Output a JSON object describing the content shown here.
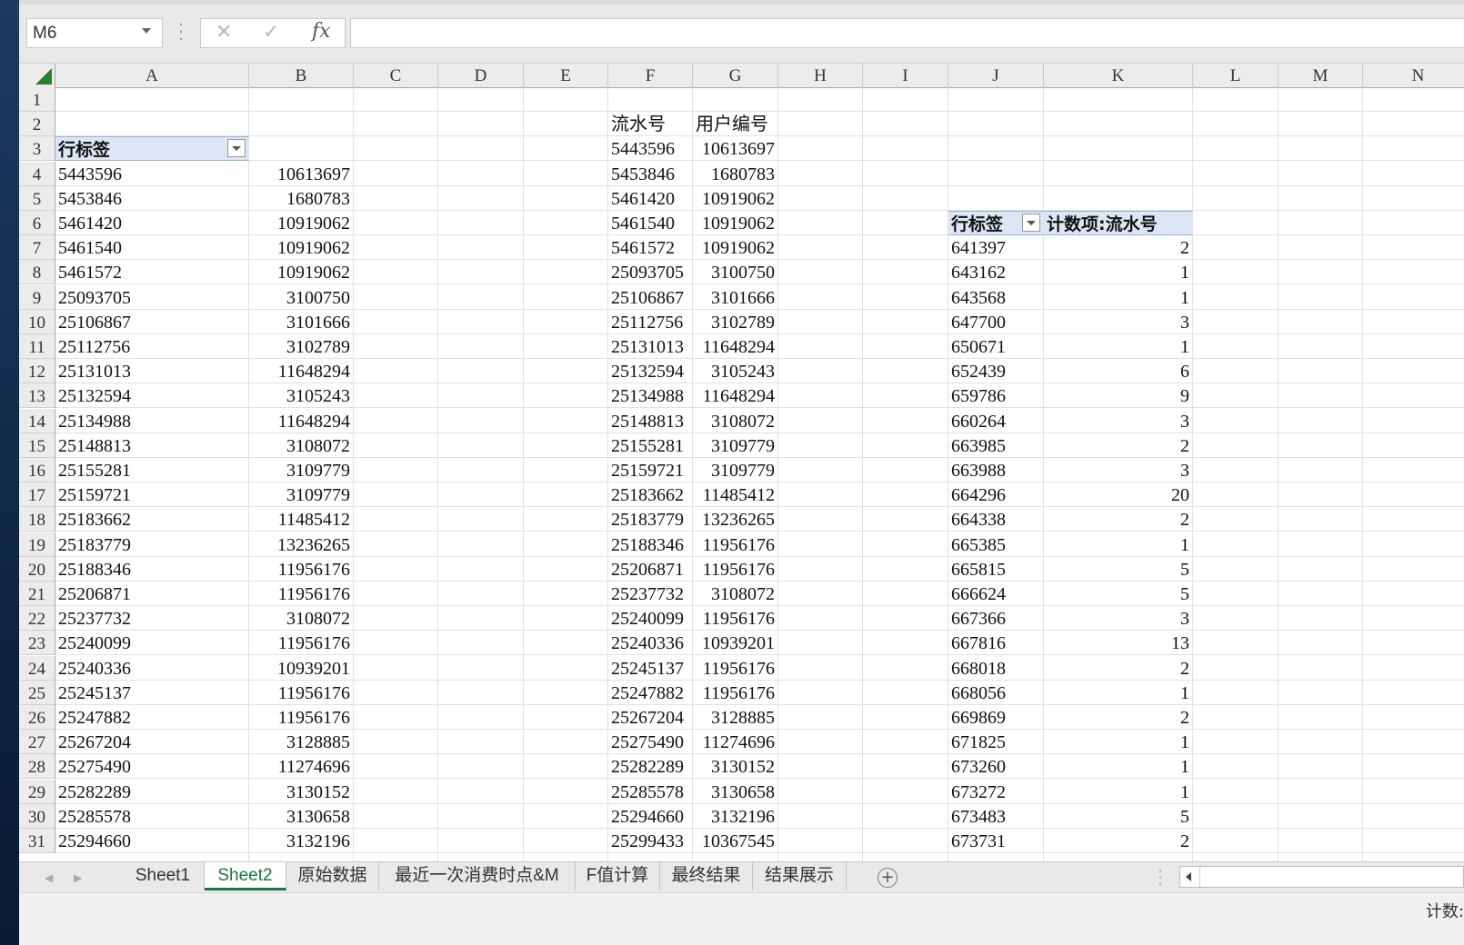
{
  "name_box": {
    "value": "M6"
  },
  "formula_bar": {
    "fx_label": "fx",
    "value": ""
  },
  "columns": [
    "A",
    "B",
    "C",
    "D",
    "E",
    "F",
    "G",
    "H",
    "I",
    "J",
    "K",
    "L",
    "M",
    "N"
  ],
  "rows": [
    "1",
    "2",
    "3",
    "4",
    "5",
    "6",
    "7",
    "8",
    "9",
    "10",
    "11",
    "12",
    "13",
    "14",
    "15",
    "16",
    "17",
    "18",
    "19",
    "20",
    "21",
    "22",
    "23",
    "24",
    "25",
    "26",
    "27",
    "28",
    "29",
    "30",
    "31"
  ],
  "pivot_left": {
    "header": "行标签",
    "rows": [
      [
        "5443596",
        "10613697"
      ],
      [
        "5453846",
        "1680783"
      ],
      [
        "5461420",
        "10919062"
      ],
      [
        "5461540",
        "10919062"
      ],
      [
        "5461572",
        "10919062"
      ],
      [
        "25093705",
        "3100750"
      ],
      [
        "25106867",
        "3101666"
      ],
      [
        "25112756",
        "3102789"
      ],
      [
        "25131013",
        "11648294"
      ],
      [
        "25132594",
        "3105243"
      ],
      [
        "25134988",
        "11648294"
      ],
      [
        "25148813",
        "3108072"
      ],
      [
        "25155281",
        "3109779"
      ],
      [
        "25159721",
        "3109779"
      ],
      [
        "25183662",
        "11485412"
      ],
      [
        "25183779",
        "13236265"
      ],
      [
        "25188346",
        "11956176"
      ],
      [
        "25206871",
        "11956176"
      ],
      [
        "25237732",
        "3108072"
      ],
      [
        "25240099",
        "11956176"
      ],
      [
        "25240336",
        "10939201"
      ],
      [
        "25245137",
        "11956176"
      ],
      [
        "25247882",
        "11956176"
      ],
      [
        "25267204",
        "3128885"
      ],
      [
        "25275490",
        "11274696"
      ],
      [
        "25282289",
        "3130152"
      ],
      [
        "25285578",
        "3130658"
      ],
      [
        "25294660",
        "3132196"
      ]
    ]
  },
  "table_fg": {
    "headers": [
      "流水号",
      "用户编号"
    ],
    "rows": [
      [
        "5443596",
        "10613697"
      ],
      [
        "5453846",
        "1680783"
      ],
      [
        "5461420",
        "10919062"
      ],
      [
        "5461540",
        "10919062"
      ],
      [
        "5461572",
        "10919062"
      ],
      [
        "25093705",
        "3100750"
      ],
      [
        "25106867",
        "3101666"
      ],
      [
        "25112756",
        "3102789"
      ],
      [
        "25131013",
        "11648294"
      ],
      [
        "25132594",
        "3105243"
      ],
      [
        "25134988",
        "11648294"
      ],
      [
        "25148813",
        "3108072"
      ],
      [
        "25155281",
        "3109779"
      ],
      [
        "25159721",
        "3109779"
      ],
      [
        "25183662",
        "11485412"
      ],
      [
        "25183779",
        "13236265"
      ],
      [
        "25188346",
        "11956176"
      ],
      [
        "25206871",
        "11956176"
      ],
      [
        "25237732",
        "3108072"
      ],
      [
        "25240099",
        "11956176"
      ],
      [
        "25240336",
        "10939201"
      ],
      [
        "25245137",
        "11956176"
      ],
      [
        "25247882",
        "11956176"
      ],
      [
        "25267204",
        "3128885"
      ],
      [
        "25275490",
        "11274696"
      ],
      [
        "25282289",
        "3130152"
      ],
      [
        "25285578",
        "3130658"
      ],
      [
        "25294660",
        "3132196"
      ],
      [
        "25299433",
        "10367545"
      ]
    ]
  },
  "pivot_right": {
    "header_label": "行标签",
    "header_value": "计数项:流水号",
    "rows": [
      [
        "641397",
        "2"
      ],
      [
        "643162",
        "1"
      ],
      [
        "643568",
        "1"
      ],
      [
        "647700",
        "3"
      ],
      [
        "650671",
        "1"
      ],
      [
        "652439",
        "6"
      ],
      [
        "659786",
        "9"
      ],
      [
        "660264",
        "3"
      ],
      [
        "663985",
        "2"
      ],
      [
        "663988",
        "3"
      ],
      [
        "664296",
        "20"
      ],
      [
        "664338",
        "2"
      ],
      [
        "665385",
        "1"
      ],
      [
        "665815",
        "5"
      ],
      [
        "666624",
        "5"
      ],
      [
        "667366",
        "3"
      ],
      [
        "667816",
        "13"
      ],
      [
        "668018",
        "2"
      ],
      [
        "668056",
        "1"
      ],
      [
        "669869",
        "2"
      ],
      [
        "671825",
        "1"
      ],
      [
        "673260",
        "1"
      ],
      [
        "673272",
        "1"
      ],
      [
        "673483",
        "5"
      ],
      [
        "673731",
        "2"
      ]
    ]
  },
  "sheet_tabs": [
    {
      "label": "Sheet1",
      "active": false
    },
    {
      "label": "Sheet2",
      "active": true
    },
    {
      "label": "原始数据",
      "active": false
    },
    {
      "label": "最近一次消费时点&M",
      "active": false
    },
    {
      "label": "F值计算",
      "active": false
    },
    {
      "label": "最终结果",
      "active": false
    },
    {
      "label": "结果展示",
      "active": false
    }
  ],
  "status_bar": {
    "text": "计数:"
  },
  "colors": {
    "accent": "#217346",
    "pivot_header_bg": "#dde6f4"
  }
}
